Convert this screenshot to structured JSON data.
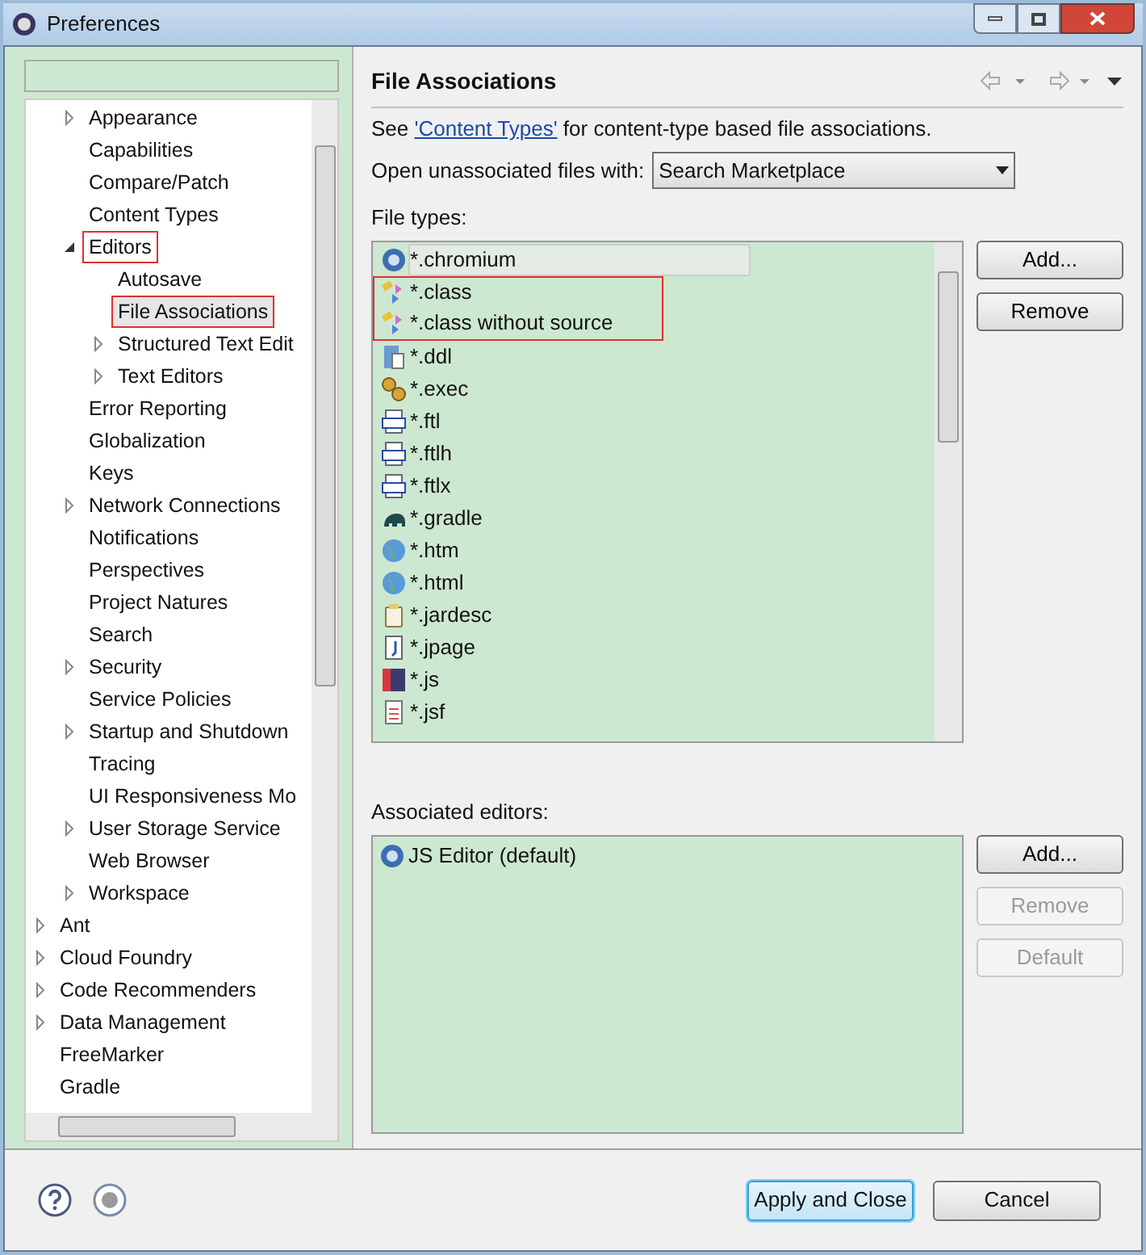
{
  "window": {
    "title": "Preferences"
  },
  "tree": {
    "nested_items": [
      {
        "label": "Appearance",
        "expandable": true,
        "expanded": false
      },
      {
        "label": "Capabilities",
        "expandable": false
      },
      {
        "label": "Compare/Patch",
        "expandable": false
      },
      {
        "label": "Content Types",
        "expandable": false
      },
      {
        "label": "Editors",
        "expandable": true,
        "expanded": true,
        "highlighted": true,
        "children": [
          {
            "label": "Autosave",
            "expandable": false,
            "selected": false
          },
          {
            "label": "File Associations",
            "expandable": false,
            "selected": true,
            "highlighted": true
          },
          {
            "label": "Structured Text Edit",
            "expandable": true,
            "expanded": false,
            "selected": false
          },
          {
            "label": "Text Editors",
            "expandable": true,
            "expanded": false,
            "selected": false
          }
        ]
      },
      {
        "label": "Error Reporting",
        "expandable": false
      },
      {
        "label": "Globalization",
        "expandable": false
      },
      {
        "label": "Keys",
        "expandable": false
      },
      {
        "label": "Network Connections",
        "expandable": true,
        "expanded": false
      },
      {
        "label": "Notifications",
        "expandable": false
      },
      {
        "label": "Perspectives",
        "expandable": false
      },
      {
        "label": "Project Natures",
        "expandable": false
      },
      {
        "label": "Search",
        "expandable": false
      },
      {
        "label": "Security",
        "expandable": true,
        "expanded": false
      },
      {
        "label": "Service Policies",
        "expandable": false
      },
      {
        "label": "Startup and Shutdown",
        "expandable": true,
        "expanded": false
      },
      {
        "label": "Tracing",
        "expandable": false
      },
      {
        "label": "UI Responsiveness Mo",
        "expandable": false
      },
      {
        "label": "User Storage Service",
        "expandable": true,
        "expanded": false
      },
      {
        "label": "Web Browser",
        "expandable": false
      },
      {
        "label": "Workspace",
        "expandable": true,
        "expanded": false
      }
    ],
    "items": [
      {
        "label": "Ant",
        "expandable": true,
        "expanded": false
      },
      {
        "label": "Cloud Foundry",
        "expandable": true,
        "expanded": false
      },
      {
        "label": "Code Recommenders",
        "expandable": true,
        "expanded": false
      },
      {
        "label": "Data Management",
        "expandable": true,
        "expanded": false
      },
      {
        "label": "FreeMarker",
        "expandable": false
      },
      {
        "label": "Gradle",
        "expandable": false
      }
    ]
  },
  "page": {
    "title": "File Associations",
    "intro_before": "See ",
    "intro_link": "'Content Types'",
    "intro_after": " for content-type based file associations.",
    "open_label": "Open unassociated files with:",
    "open_value": "Search Marketplace",
    "file_types_label": "File types:",
    "file_types": [
      {
        "label": "*.chromium",
        "kind": "browser",
        "selected": true,
        "highlighted": false
      },
      {
        "label": "*.class",
        "kind": "class",
        "selected": false,
        "highlighted": true
      },
      {
        "label": "*.class without source",
        "kind": "class",
        "selected": false,
        "highlighted": true
      },
      {
        "label": "*.ddl",
        "kind": "ddl",
        "selected": false,
        "highlighted": false
      },
      {
        "label": "*.exec",
        "kind": "gears",
        "selected": false,
        "highlighted": false
      },
      {
        "label": "*.ftl",
        "kind": "template",
        "selected": false,
        "highlighted": false
      },
      {
        "label": "*.ftlh",
        "kind": "template",
        "selected": false,
        "highlighted": false
      },
      {
        "label": "*.ftlx",
        "kind": "template",
        "selected": false,
        "highlighted": false
      },
      {
        "label": "*.gradle",
        "kind": "elephant",
        "selected": false,
        "highlighted": false
      },
      {
        "label": "*.htm",
        "kind": "globe",
        "selected": false,
        "highlighted": false
      },
      {
        "label": "*.html",
        "kind": "globe",
        "selected": false,
        "highlighted": false
      },
      {
        "label": "*.jardesc",
        "kind": "jar",
        "selected": false,
        "highlighted": false
      },
      {
        "label": "*.jpage",
        "kind": "jpage",
        "selected": false,
        "highlighted": false
      },
      {
        "label": "*.js",
        "kind": "js",
        "selected": false,
        "highlighted": false
      },
      {
        "label": "*.jsf",
        "kind": "doc",
        "selected": false,
        "highlighted": false
      }
    ],
    "file_type_buttons": [
      {
        "label": "Add...",
        "disabled": false
      },
      {
        "label": "Remove",
        "disabled": false
      }
    ],
    "editors_label": "Associated editors:",
    "editors": [
      {
        "label": "JS Editor (default)",
        "kind": "browser"
      }
    ],
    "editor_buttons": [
      {
        "label": "Add...",
        "disabled": false
      },
      {
        "label": "Remove",
        "disabled": true
      },
      {
        "label": "Default",
        "disabled": true
      }
    ]
  },
  "footer": {
    "buttons": [
      {
        "label": "Apply and Close",
        "default": true
      },
      {
        "label": "Cancel",
        "default": false
      }
    ]
  }
}
